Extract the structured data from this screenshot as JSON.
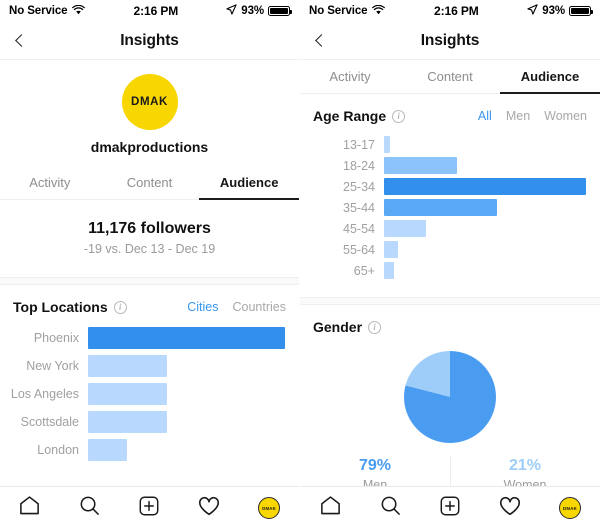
{
  "status_bar": {
    "carrier": "No Service",
    "wifi_icon": "wifi-icon",
    "time": "2:16 PM",
    "location_icon": "location-arrow-icon",
    "battery_pct": "93%",
    "battery_icon": "battery-icon"
  },
  "nav": {
    "back_icon": "chevron-left-icon",
    "title": "Insights"
  },
  "left_panel": {
    "profile": {
      "avatar_text": "DMAK",
      "avatar_color": "#F8D600",
      "username": "dmakproductions"
    },
    "tabs": [
      {
        "label": "Activity",
        "active": false
      },
      {
        "label": "Content",
        "active": false
      },
      {
        "label": "Audience",
        "active": true
      }
    ],
    "followers": {
      "count": "11,176 followers",
      "change": "-19 vs. Dec 13 - Dec 19"
    },
    "top_locations": {
      "title": "Top Locations",
      "info_icon": "info-icon",
      "segments": [
        {
          "label": "Cities",
          "active": true
        },
        {
          "label": "Countries",
          "active": false
        }
      ]
    }
  },
  "right_panel": {
    "tabs": [
      {
        "label": "Activity",
        "active": false
      },
      {
        "label": "Content",
        "active": false
      },
      {
        "label": "Audience",
        "active": true
      }
    ],
    "age_range": {
      "title": "Age Range",
      "info_icon": "info-icon",
      "segments": [
        {
          "label": "All",
          "active": true
        },
        {
          "label": "Men",
          "active": false
        },
        {
          "label": "Women",
          "active": false
        }
      ]
    },
    "gender": {
      "title": "Gender",
      "info_icon": "info-icon"
    }
  },
  "tab_bar": {
    "items": [
      {
        "icon": "home-icon",
        "label": "Home"
      },
      {
        "icon": "search-icon",
        "label": "Search"
      },
      {
        "icon": "add-post-icon",
        "label": "Add"
      },
      {
        "icon": "heart-icon",
        "label": "Activity"
      },
      {
        "icon": "profile-avatar-icon",
        "label": "Profile"
      }
    ],
    "avatar_text": "DMAK"
  },
  "colors": {
    "accent_blue": "#3897f0",
    "bar_dark": "#3290ec",
    "bar_medium": "#5aa9f7",
    "bar_light": "#a8d1fb",
    "bar_lighter": "#b8d9fd",
    "text_gray": "#9a9a9a",
    "brand_yellow": "#F8D600"
  },
  "chart_data": [
    {
      "type": "bar",
      "title": "Top Locations",
      "orientation": "horizontal",
      "categories": [
        "Phoenix",
        "New York",
        "Los Angeles",
        "Scottsdale",
        "London"
      ],
      "values": [
        100,
        40,
        40,
        40,
        20
      ],
      "colors": [
        "#3290ec",
        "#b8d9fd",
        "#b8d9fd",
        "#b8d9fd",
        "#b8d9fd"
      ],
      "xlabel": "",
      "ylabel": "",
      "xlim": [
        0,
        100
      ],
      "grid": false,
      "legend": false,
      "selected_segment": "Cities"
    },
    {
      "type": "bar",
      "title": "Age Range",
      "orientation": "horizontal",
      "categories": [
        "13-17",
        "18-24",
        "25-34",
        "35-44",
        "45-54",
        "55-64",
        "65+"
      ],
      "values": [
        3,
        36,
        100,
        56,
        21,
        7,
        5
      ],
      "colors": [
        "#b8d9fd",
        "#8cc3fa",
        "#3290ec",
        "#5aa9f7",
        "#b8d9fd",
        "#b8d9fd",
        "#b8d9fd"
      ],
      "xlabel": "",
      "ylabel": "",
      "xlim": [
        0,
        100
      ],
      "grid": false,
      "legend": false,
      "selected_segment": "All"
    },
    {
      "type": "pie",
      "title": "Gender",
      "labels": [
        "Men",
        "Women"
      ],
      "values": [
        79,
        21
      ],
      "value_labels": [
        "79%",
        "21%"
      ],
      "colors": [
        "#4a9cf0",
        "#9ecdfa"
      ],
      "legend": true,
      "legend_position": "bottom",
      "start_angle_deg": 0
    }
  ]
}
